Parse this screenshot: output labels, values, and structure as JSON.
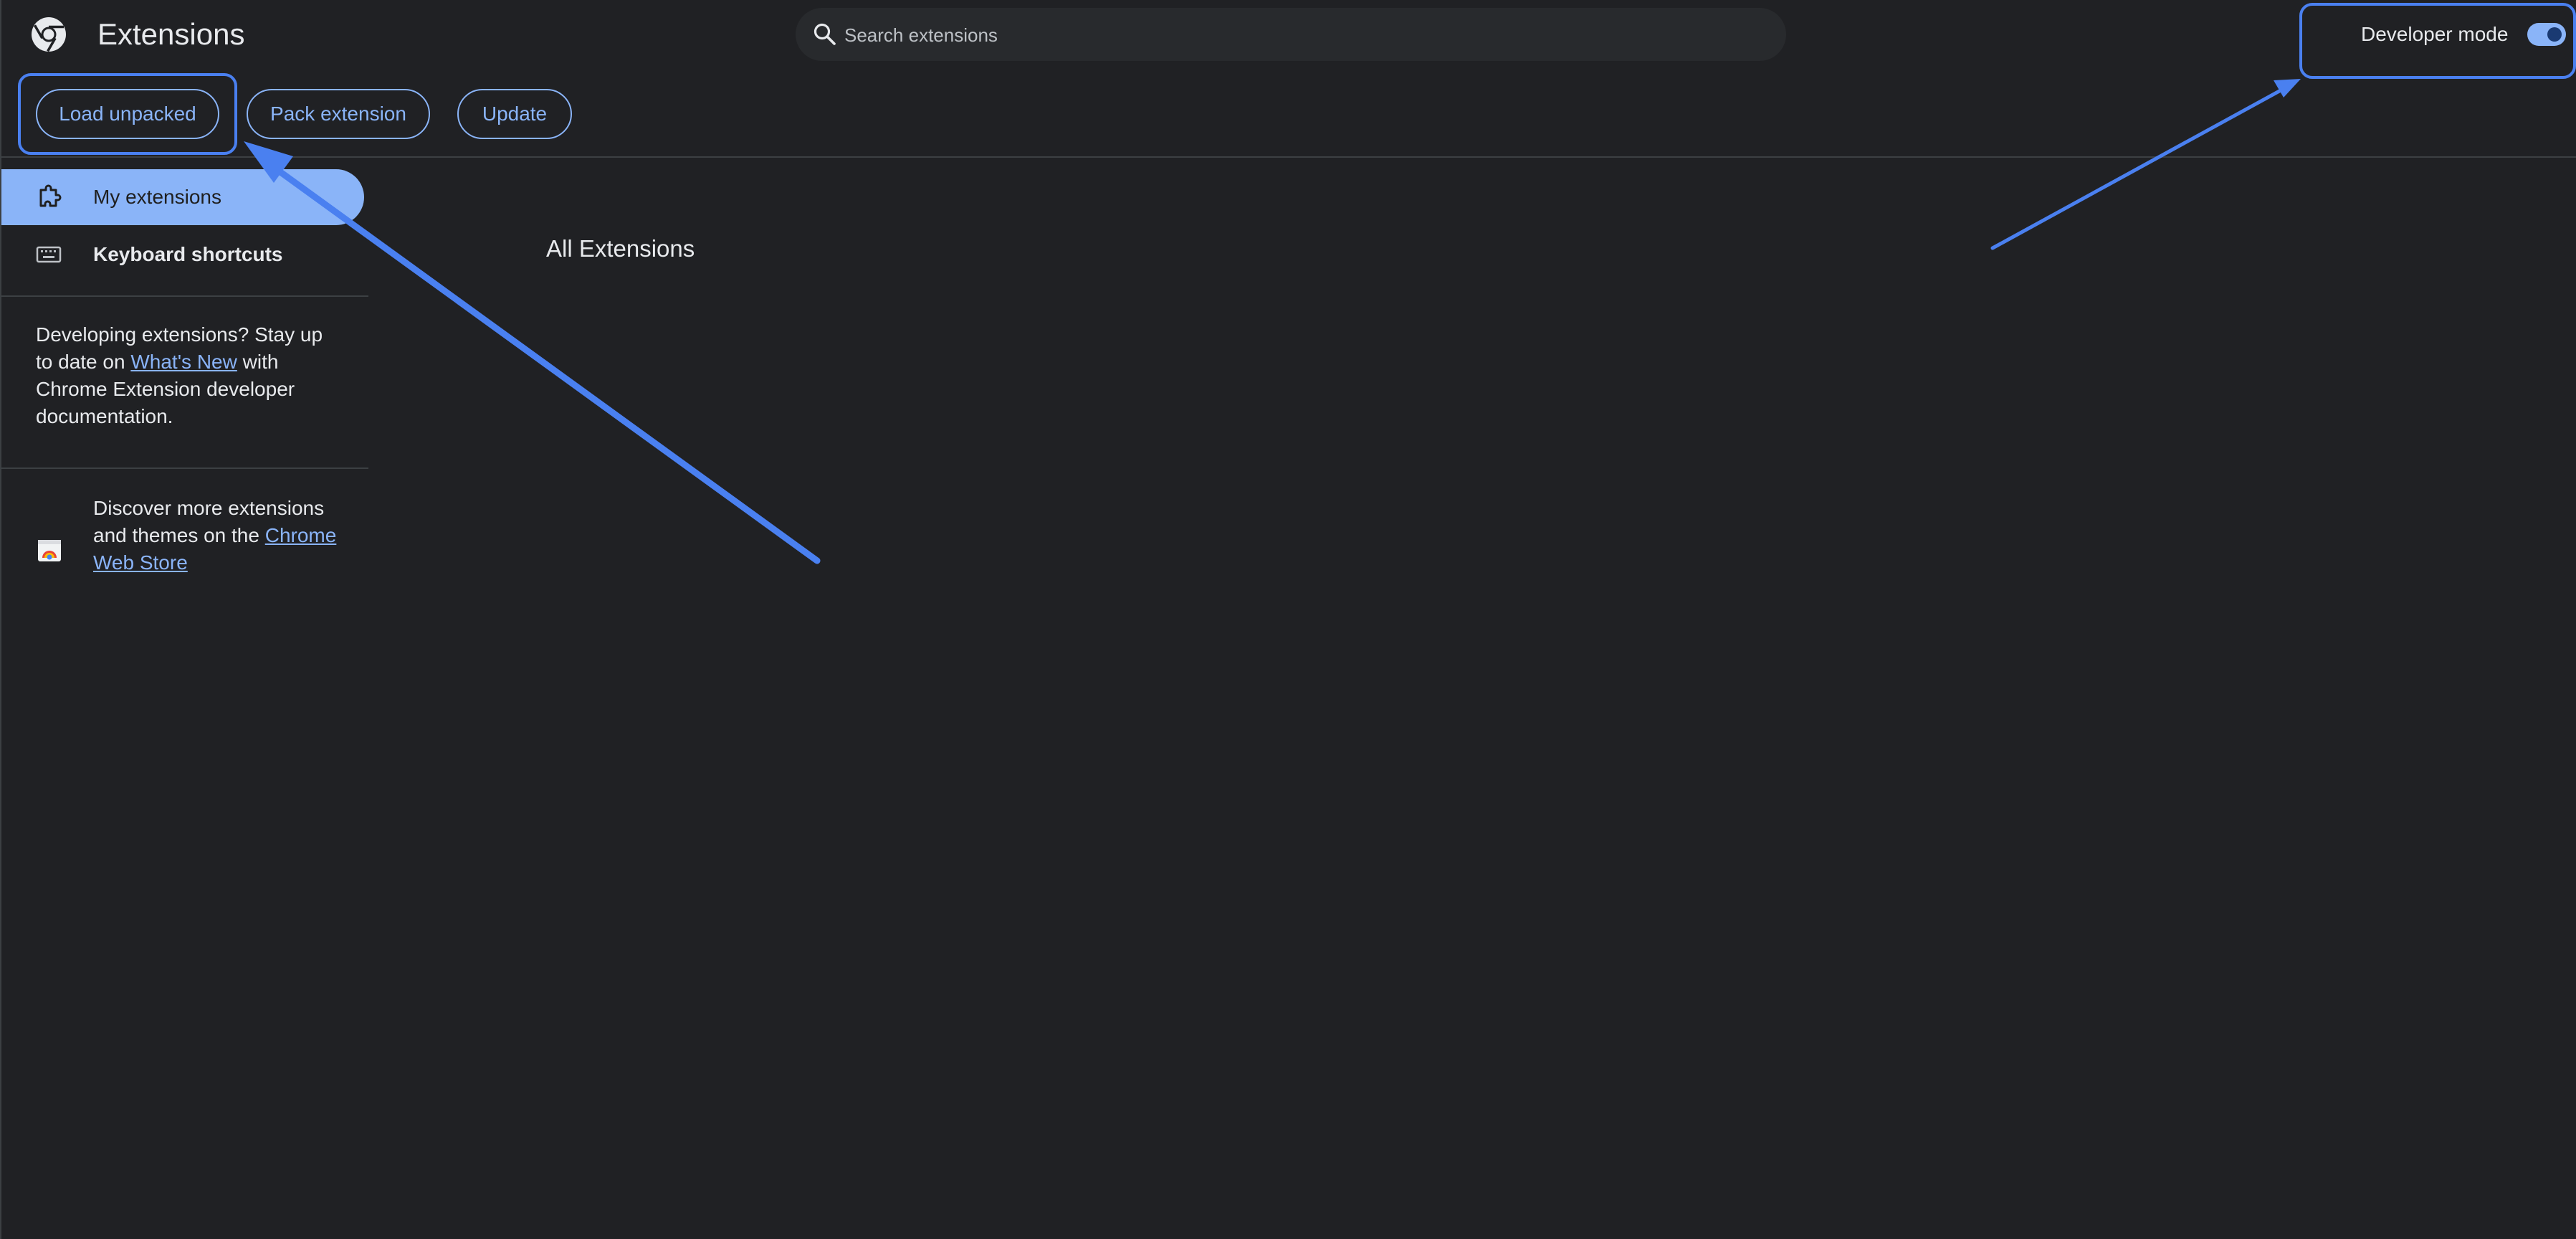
{
  "header": {
    "title": "Extensions",
    "search_placeholder": "Search extensions",
    "developer_mode_label": "Developer mode",
    "developer_mode_on": true
  },
  "toolbar": {
    "load_unpacked": "Load unpacked",
    "pack_extension": "Pack extension",
    "update": "Update"
  },
  "sidebar": {
    "items": [
      {
        "label": "My extensions",
        "icon": "puzzle-piece-icon",
        "active": true
      },
      {
        "label": "Keyboard shortcuts",
        "icon": "keyboard-icon",
        "active": false
      }
    ],
    "dev_note": {
      "before": "Developing extensions? Stay up to date on ",
      "link": "What's New",
      "after": " with Chrome Extension developer documentation."
    },
    "store_note": {
      "before": "Discover more extensions and themes on the ",
      "link": "Chrome Web Store"
    }
  },
  "main": {
    "section_title": "All Extensions"
  },
  "colors": {
    "background": "#202124",
    "accent": "#8ab4f8",
    "annotation": "#4a80f0"
  }
}
